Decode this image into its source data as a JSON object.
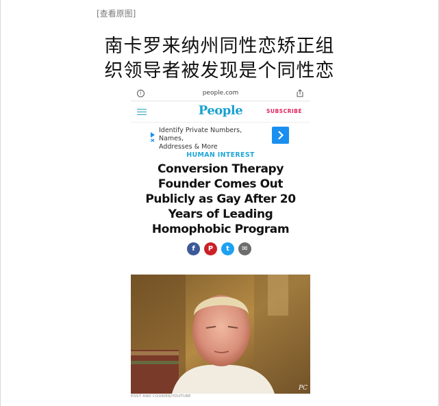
{
  "view_original_link": "[查看原图]",
  "cn_headline": {
    "line1": "南卡罗来纳州同性恋矫正组",
    "line2": "织领导者被发现是个同性恋"
  },
  "browser": {
    "url": "people.com",
    "info_icon": "info-icon",
    "share_icon": "share-icon"
  },
  "site": {
    "logo": "People",
    "subscribe": "SUBSCRIBE",
    "menu_icon": "hamburger-icon"
  },
  "ad": {
    "text_line1": "Identify Private Numbers, Names,",
    "text_line2": "Addresses & More",
    "button_icon": "chevron-right-icon",
    "marker_icon": "adchoices-icon"
  },
  "article": {
    "category": "HUMAN INTEREST",
    "title_lines": [
      "Conversion Therapy",
      "Founder Comes Out",
      "Publicly as Gay After 20",
      "Years of Leading",
      "Homophobic Program"
    ]
  },
  "share_buttons": [
    {
      "icon": "facebook-icon",
      "glyph": "f"
    },
    {
      "icon": "pinterest-icon",
      "glyph": "P"
    },
    {
      "icon": "twitter-icon",
      "glyph": "t"
    },
    {
      "icon": "email-icon",
      "glyph": "✉"
    }
  ],
  "photo": {
    "caption": "POST AND COURIER/YOUTUBE",
    "watermark": "PC"
  },
  "colors": {
    "people_blue": "#1aa0cf",
    "subscribe_pink": "#e0245e",
    "ad_button": "#1a8ff0",
    "facebook": "#3b5998",
    "pinterest": "#cb2027",
    "twitter": "#1da1f2",
    "email": "#6d6d6d"
  }
}
